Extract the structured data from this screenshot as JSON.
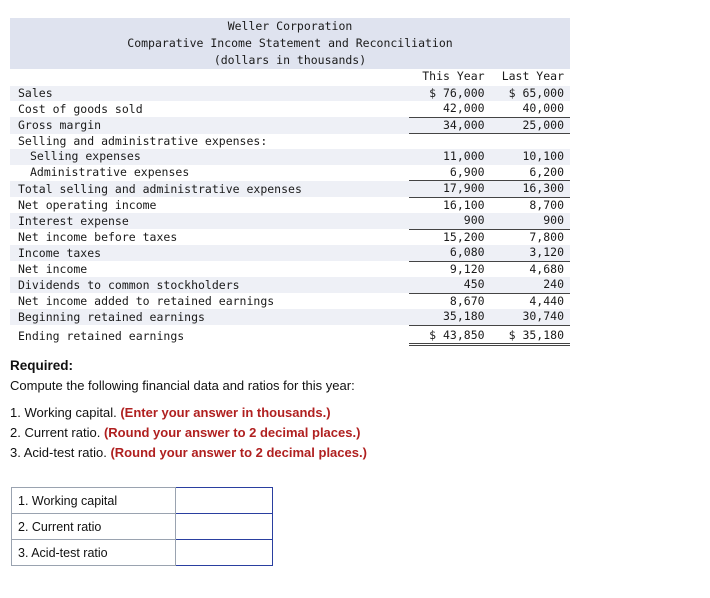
{
  "statement": {
    "title_lines": [
      "Weller Corporation",
      "Comparative Income Statement and Reconciliation",
      "(dollars in thousands)"
    ],
    "columns": [
      "This Year",
      "Last Year"
    ],
    "rows": [
      {
        "label": "Sales",
        "this_year": "$ 76,000",
        "last_year": "$ 65,000"
      },
      {
        "label": "Cost of goods sold",
        "this_year": "42,000",
        "last_year": "40,000"
      },
      {
        "label": "Gross margin",
        "this_year": "34,000",
        "last_year": "25,000"
      },
      {
        "label": "Selling and administrative expenses:",
        "this_year": "",
        "last_year": ""
      },
      {
        "label": "Selling expenses",
        "this_year": "11,000",
        "last_year": "10,100"
      },
      {
        "label": "Administrative expenses",
        "this_year": "6,900",
        "last_year": "6,200"
      },
      {
        "label": "Total selling and administrative expenses",
        "this_year": "17,900",
        "last_year": "16,300"
      },
      {
        "label": "Net operating income",
        "this_year": "16,100",
        "last_year": "8,700"
      },
      {
        "label": "Interest expense",
        "this_year": "900",
        "last_year": "900"
      },
      {
        "label": "Net income before taxes",
        "this_year": "15,200",
        "last_year": "7,800"
      },
      {
        "label": "Income taxes",
        "this_year": "6,080",
        "last_year": "3,120"
      },
      {
        "label": "Net income",
        "this_year": "9,120",
        "last_year": "4,680"
      },
      {
        "label": "Dividends to common stockholders",
        "this_year": "450",
        "last_year": "240"
      },
      {
        "label": "Net income added to retained earnings",
        "this_year": "8,670",
        "last_year": "4,440"
      },
      {
        "label": "Beginning retained earnings",
        "this_year": "35,180",
        "last_year": "30,740"
      },
      {
        "label": "Ending retained earnings",
        "this_year": "$ 43,850",
        "last_year": "$ 35,180"
      }
    ]
  },
  "required": {
    "heading": "Required:",
    "lede": "Compute the following financial data and ratios for this year:",
    "items": [
      {
        "num": "1.",
        "text": "Working capital.",
        "emphasis": "(Enter your answer in thousands.)"
      },
      {
        "num": "2.",
        "text": "Current ratio.",
        "emphasis": "(Round your answer to 2 decimal places.)"
      },
      {
        "num": "3.",
        "text": "Acid-test ratio.",
        "emphasis": "(Round your answer to 2 decimal places.)"
      }
    ]
  },
  "answer_table": {
    "rows": [
      {
        "label": "1. Working capital",
        "value": "",
        "placeholder": ""
      },
      {
        "label": "2. Current ratio",
        "value": "",
        "placeholder": ""
      },
      {
        "label": "3. Acid-test ratio",
        "value": "",
        "placeholder": ""
      }
    ]
  }
}
